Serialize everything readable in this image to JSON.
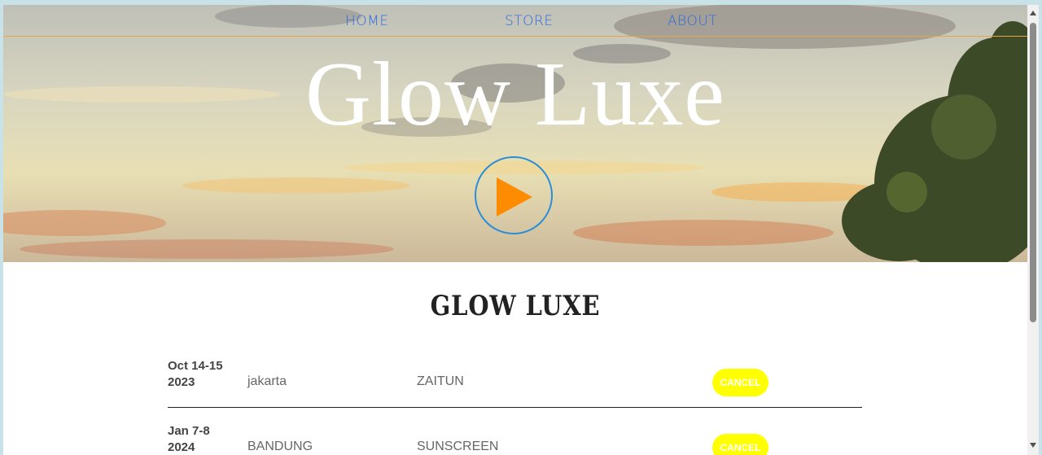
{
  "nav": {
    "items": [
      {
        "label": "HOME"
      },
      {
        "label": "STORE"
      },
      {
        "label": "ABOUT"
      }
    ]
  },
  "hero": {
    "title": "Glow Luxe",
    "play_icon": "play-icon"
  },
  "section": {
    "title": "GLOW LUXE"
  },
  "tour": {
    "rows": [
      {
        "date_line1": "Oct 14-15",
        "date_line2": "2023",
        "city": "jakarta",
        "venue": "ZAITUN",
        "button": "CANCEL"
      },
      {
        "date_line1": "Jan 7-8",
        "date_line2": "2024",
        "city": "BANDUNG",
        "venue": "SUNSCREEN",
        "button": "CANCEL"
      }
    ]
  },
  "colors": {
    "nav_link": "#2d6ae0",
    "nav_border": "#e8a544",
    "play_ring": "#2a8fd6",
    "play_fill": "#ff8c00",
    "button_bg": "#ffff00"
  }
}
